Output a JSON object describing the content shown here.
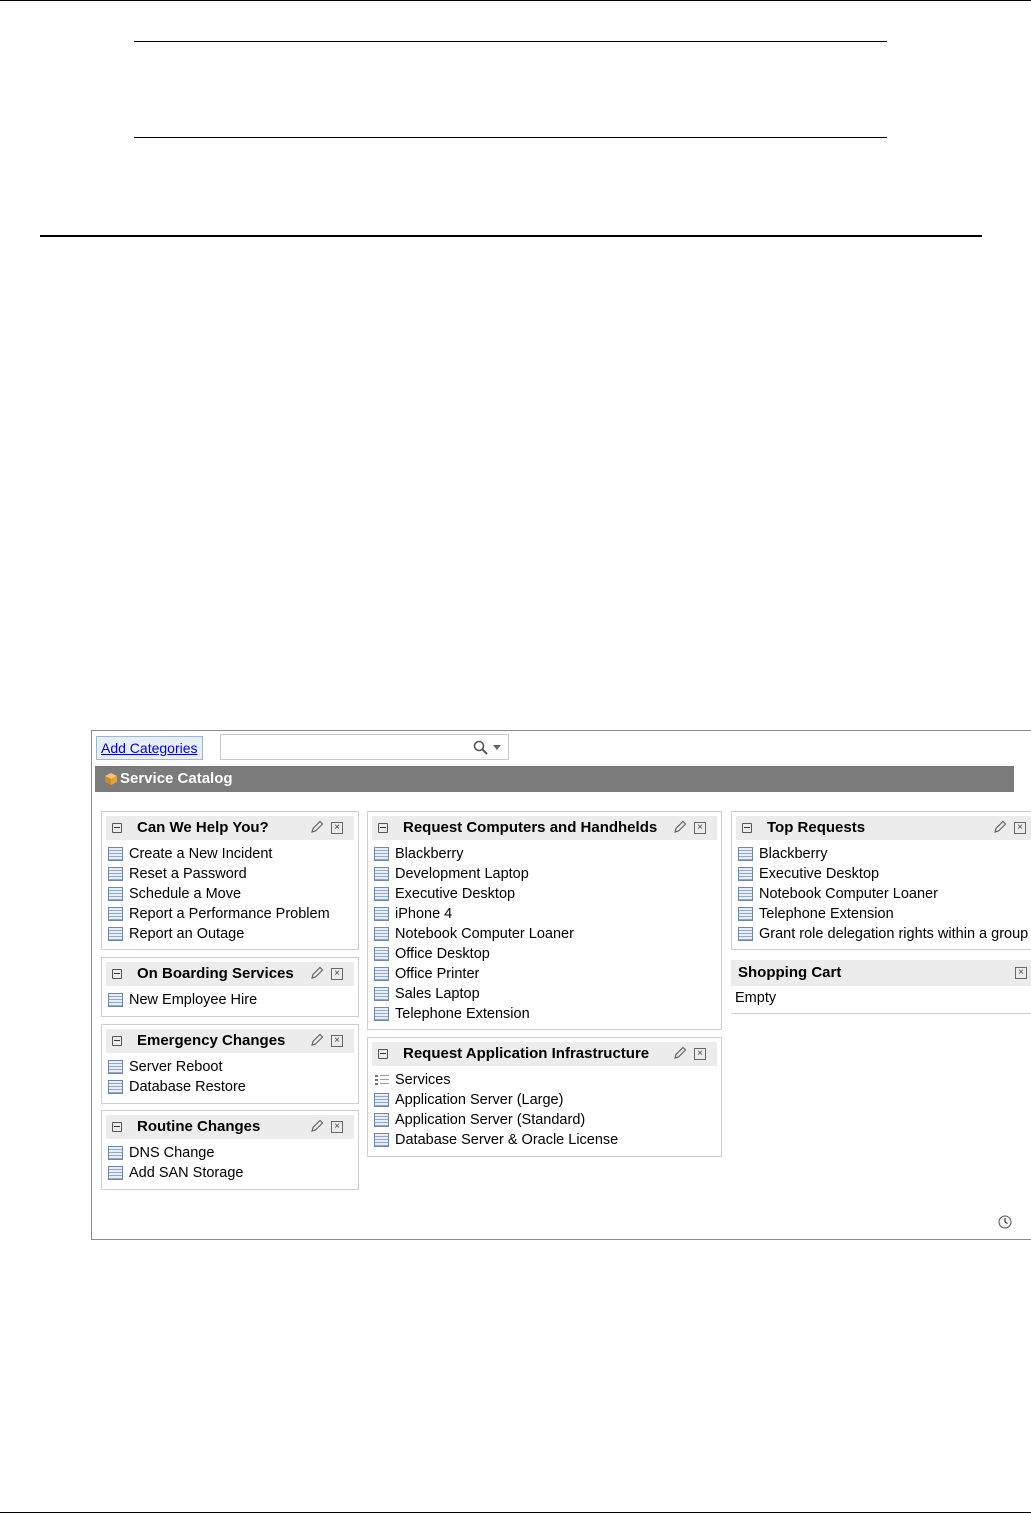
{
  "toolbar": {
    "add_categories_label": "Add Categories",
    "search": {
      "value": "",
      "placeholder": ""
    }
  },
  "service_catalog_title": "Service Catalog",
  "widgets": {
    "can_we_help": {
      "title": "Can We Help You?",
      "items": [
        "Create a New Incident",
        "Reset a Password",
        "Schedule a Move",
        "Report a Performance Problem",
        "Report an Outage"
      ]
    },
    "on_boarding": {
      "title": "On Boarding Services",
      "items": [
        "New Employee Hire"
      ]
    },
    "emergency_changes": {
      "title": "Emergency Changes",
      "items": [
        "Server Reboot",
        "Database Restore"
      ]
    },
    "routine_changes": {
      "title": "Routine Changes",
      "items": [
        "DNS Change",
        "Add SAN Storage"
      ]
    },
    "request_computers": {
      "title": "Request Computers and Handhelds",
      "items": [
        "Blackberry",
        "Development Laptop",
        "Executive Desktop",
        "iPhone 4",
        "Notebook Computer Loaner",
        "Office Desktop",
        "Office Printer",
        "Sales Laptop",
        "Telephone Extension"
      ]
    },
    "request_app_infra": {
      "title": "Request Application Infrastructure",
      "items": [
        "Services",
        "Application Server (Large)",
        "Application Server (Standard)",
        "Database Server & Oracle License"
      ]
    },
    "top_requests": {
      "title": "Top Requests",
      "items": [
        "Blackberry",
        "Executive Desktop",
        "Notebook Computer Loaner",
        "Telephone Extension",
        "Grant role delegation rights within a group"
      ]
    },
    "shopping_cart": {
      "title": "Shopping Cart",
      "empty_label": "Empty"
    }
  }
}
